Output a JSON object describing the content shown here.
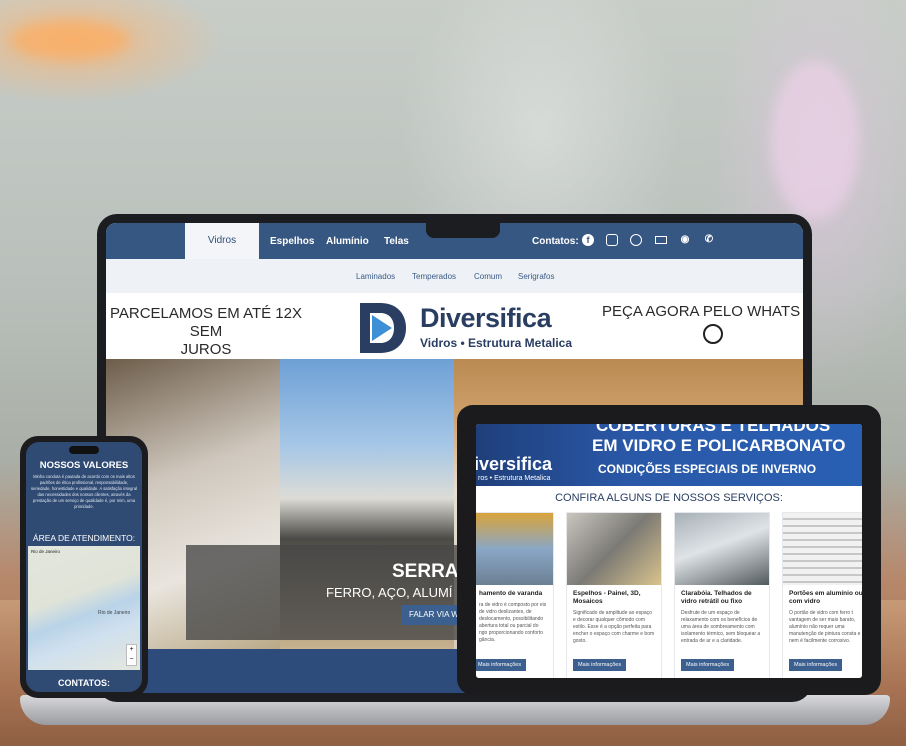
{
  "laptop": {
    "nav": {
      "items": [
        "Vidros",
        "Espelhos",
        "Alumínio",
        "Telas"
      ],
      "active": "Vidros",
      "contacts_label": "Contatos:",
      "contact_icons": [
        "facebook-icon",
        "instagram-icon",
        "whatsapp-icon",
        "email-icon",
        "location-icon",
        "phone-icon"
      ]
    },
    "subnav": [
      "Laminados",
      "Temperados",
      "Comum",
      "Serigrafos"
    ],
    "banner": {
      "left_promo_line1": "PARCELAMOS EM ATÉ 12X SEM",
      "left_promo_line2": "JUROS",
      "brand": "Diversifica",
      "brand_sub": "Vidros • Estrutura Metalica",
      "right_promo": "PEÇA AGORA PELO WHATS"
    },
    "hero": {
      "title": "SERRAL",
      "subtitle": "FERRO, AÇO, ALUMÍ",
      "button": "FALAR VIA W"
    }
  },
  "tablet": {
    "banner_line1": "COBERTURAS E TELHADOS",
    "banner_line2": "EM VIDRO E POLICARBONATO",
    "banner_line3": "CONDIÇÕES ESPECIAIS DE INVERNO",
    "brand": "iversifica",
    "brand_sub": "ros • Estrutura Metalica",
    "section_title": "CONFIRA ALGUNS DE NOSSOS SERVIÇOS:",
    "cards": [
      {
        "title": "hamento de varanda",
        "text": "ra de vidro é composto por eis de vidro deslizantes, de deslocamento, possibilitando abertura total ou parcial do ngo proporcionando conforto gância.",
        "button": "Mais informações"
      },
      {
        "title": "Espelhos - Painel, 3D, Mosaicos",
        "text": "Significado de amplitude ao espaço e decorar qualquer cômodo com estilo. Esse é a opção perfeita para encher o espaço com charme e bom gosto.",
        "button": "Mais informações"
      },
      {
        "title": "Clarabóia. Telhados de vidro retrátil ou fixo",
        "text": "Desfrute de um espaço de relaxamento com os benefícios de uma área de sombreamento com isolamento térmico, sem bloquear a entrada de ar e a claridade.",
        "button": "Mais informações"
      },
      {
        "title": "Portões em alumínio ou com vidro",
        "text": "O portão de vidro com ferro t vantagem de ser mais barato, alumínio não requer uma manutenção de pintura consta e nem é facilmente corrosivo.",
        "button": "Mais informações"
      }
    ]
  },
  "phone": {
    "title": "NOSSOS VALORES",
    "values_text": "Minha conduta é pautada de acordo com os mais altos padrões de ética profissional, responsabilidade, seriedade, honestidade e qualidade. A satisfação integral das necessidades dos nossos clientes, através da prestação de um serviço de qualidade é, por mim, uma prioridade.",
    "area_title": "ÁREA DE ATENDIMENTO:",
    "map_label": "Rio de Janeiro",
    "map_city": "Rio de Janeiro",
    "zoom_in": "+",
    "zoom_out": "−",
    "contacts_title": "CONTATOS:"
  }
}
